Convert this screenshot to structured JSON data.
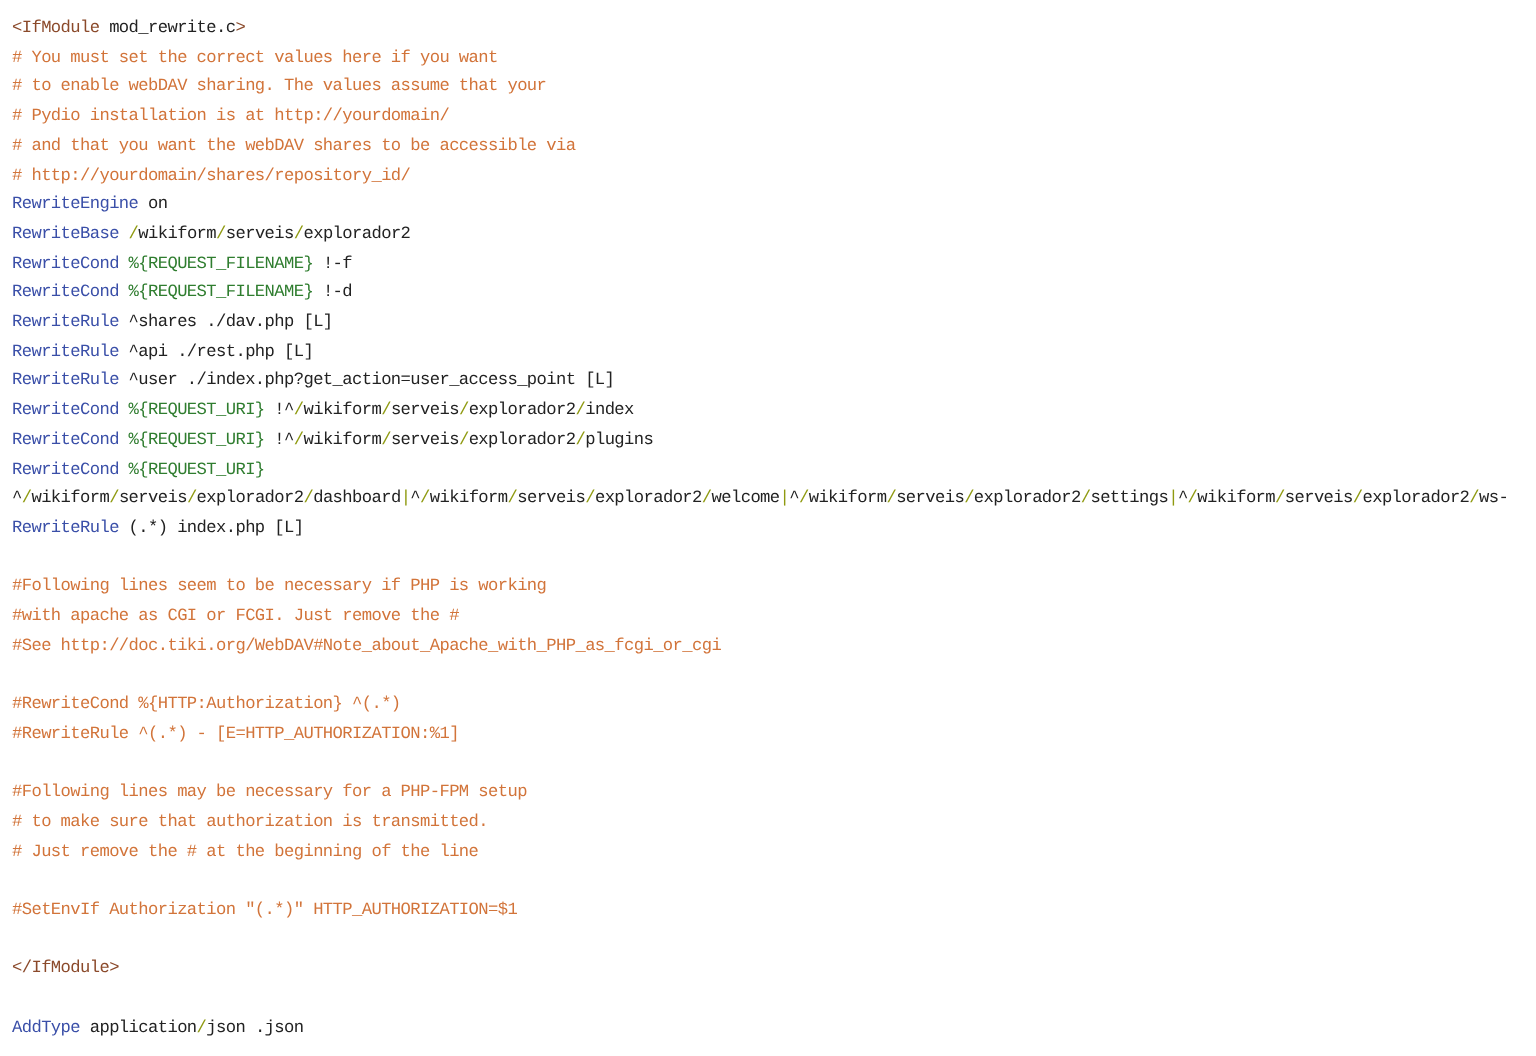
{
  "code_lines": [
    {
      "kind": "code",
      "tokens": [
        {
          "kind": "tag",
          "text": "<IfModule"
        },
        {
          "kind": "text",
          "text": " mod_rewrite.c"
        },
        {
          "kind": "tag",
          "text": ">"
        }
      ]
    },
    {
      "kind": "code",
      "tokens": [
        {
          "kind": "comment",
          "text": "# You must set the correct values here if you want"
        }
      ]
    },
    {
      "kind": "code",
      "tokens": [
        {
          "kind": "comment",
          "text": "# to enable webDAV sharing. The values assume that your"
        }
      ]
    },
    {
      "kind": "code",
      "tokens": [
        {
          "kind": "comment",
          "text": "# Pydio installation is at http://yourdomain/"
        }
      ]
    },
    {
      "kind": "code",
      "tokens": [
        {
          "kind": "comment",
          "text": "# and that you want the webDAV shares to be accessible via"
        }
      ]
    },
    {
      "kind": "code",
      "tokens": [
        {
          "kind": "comment",
          "text": "# http://yourdomain/shares/repository_id/"
        }
      ]
    },
    {
      "kind": "code",
      "tokens": [
        {
          "kind": "keyword",
          "text": "RewriteEngine"
        },
        {
          "kind": "text",
          "text": " on"
        }
      ]
    },
    {
      "kind": "code",
      "tokens": [
        {
          "kind": "keyword",
          "text": "RewriteBase"
        },
        {
          "kind": "path",
          "text": " /wikiform/serveis/explorador2"
        }
      ]
    },
    {
      "kind": "code",
      "tokens": [
        {
          "kind": "keyword",
          "text": "RewriteCond"
        },
        {
          "kind": "variable",
          "text": " %{REQUEST_FILENAME}"
        },
        {
          "kind": "text",
          "text": " !-f"
        }
      ]
    },
    {
      "kind": "code",
      "tokens": [
        {
          "kind": "keyword",
          "text": "RewriteCond"
        },
        {
          "kind": "variable",
          "text": " %{REQUEST_FILENAME}"
        },
        {
          "kind": "text",
          "text": " !-d"
        }
      ]
    },
    {
      "kind": "code",
      "tokens": [
        {
          "kind": "keyword",
          "text": "RewriteRule"
        },
        {
          "kind": "text",
          "text": " ^shares ./dav.php [L]"
        }
      ]
    },
    {
      "kind": "code",
      "tokens": [
        {
          "kind": "keyword",
          "text": "RewriteRule"
        },
        {
          "kind": "text",
          "text": " ^api ./rest.php [L]"
        }
      ]
    },
    {
      "kind": "code",
      "tokens": [
        {
          "kind": "keyword",
          "text": "RewriteRule"
        },
        {
          "kind": "text",
          "text": " ^user ./index.php?get_action=user_access_point [L]"
        }
      ]
    },
    {
      "kind": "code",
      "tokens": [
        {
          "kind": "keyword",
          "text": "RewriteCond"
        },
        {
          "kind": "variable",
          "text": " %{REQUEST_URI}"
        },
        {
          "kind": "text",
          "text": " !^"
        },
        {
          "kind": "path",
          "text": "/wikiform/serveis/explorador2/index"
        }
      ]
    },
    {
      "kind": "code",
      "tokens": [
        {
          "kind": "keyword",
          "text": "RewriteCond"
        },
        {
          "kind": "variable",
          "text": " %{REQUEST_URI}"
        },
        {
          "kind": "text",
          "text": " !^"
        },
        {
          "kind": "path",
          "text": "/wikiform/serveis/explorador2/plugins"
        }
      ]
    },
    {
      "kind": "code",
      "tokens": [
        {
          "kind": "keyword",
          "text": "RewriteCond"
        },
        {
          "kind": "variable",
          "text": " %{REQUEST_URI}"
        }
      ]
    },
    {
      "kind": "code",
      "tokens": [
        {
          "kind": "path",
          "text": "^/wikiform/serveis/explorador2/dashboard|^/wikiform/serveis/explorador2/welcome|^/wikiform/serveis/explorador2/settings|^/wikiform/serveis/explorador2/ws-"
        }
      ]
    },
    {
      "kind": "code",
      "tokens": [
        {
          "kind": "keyword",
          "text": "RewriteRule"
        },
        {
          "kind": "text",
          "text": " (.*) index.php [L]"
        }
      ]
    },
    {
      "kind": "blank"
    },
    {
      "kind": "code",
      "tokens": [
        {
          "kind": "comment",
          "text": "#Following lines seem to be necessary if PHP is working"
        }
      ]
    },
    {
      "kind": "code",
      "tokens": [
        {
          "kind": "comment",
          "text": "#with apache as CGI or FCGI. Just remove the #"
        }
      ]
    },
    {
      "kind": "code",
      "tokens": [
        {
          "kind": "comment",
          "text": "#See http://doc.tiki.org/WebDAV#Note_about_Apache_with_PHP_as_fcgi_or_cgi"
        }
      ]
    },
    {
      "kind": "blank"
    },
    {
      "kind": "code",
      "tokens": [
        {
          "kind": "comment",
          "text": "#RewriteCond %{HTTP:Authorization} ^(.*)"
        }
      ]
    },
    {
      "kind": "code",
      "tokens": [
        {
          "kind": "comment",
          "text": "#RewriteRule ^(.*) - [E=HTTP_AUTHORIZATION:%1]"
        }
      ]
    },
    {
      "kind": "blank"
    },
    {
      "kind": "code",
      "tokens": [
        {
          "kind": "comment",
          "text": "#Following lines may be necessary for a PHP-FPM setup"
        }
      ]
    },
    {
      "kind": "code",
      "tokens": [
        {
          "kind": "comment",
          "text": "# to make sure that authorization is transmitted."
        }
      ]
    },
    {
      "kind": "code",
      "tokens": [
        {
          "kind": "comment",
          "text": "# Just remove the # at the beginning of the line"
        }
      ]
    },
    {
      "kind": "blank"
    },
    {
      "kind": "code",
      "tokens": [
        {
          "kind": "comment",
          "text": "#SetEnvIf Authorization \"(.*)\" HTTP_AUTHORIZATION=$1"
        }
      ]
    },
    {
      "kind": "blank"
    },
    {
      "kind": "code",
      "tokens": [
        {
          "kind": "tag",
          "text": "</IfModule>"
        }
      ]
    },
    {
      "kind": "blank"
    },
    {
      "kind": "code",
      "tokens": [
        {
          "kind": "keyword",
          "text": "AddType"
        },
        {
          "kind": "path",
          "text": " application/json"
        },
        {
          "kind": "text",
          "text": " .json"
        }
      ]
    }
  ]
}
